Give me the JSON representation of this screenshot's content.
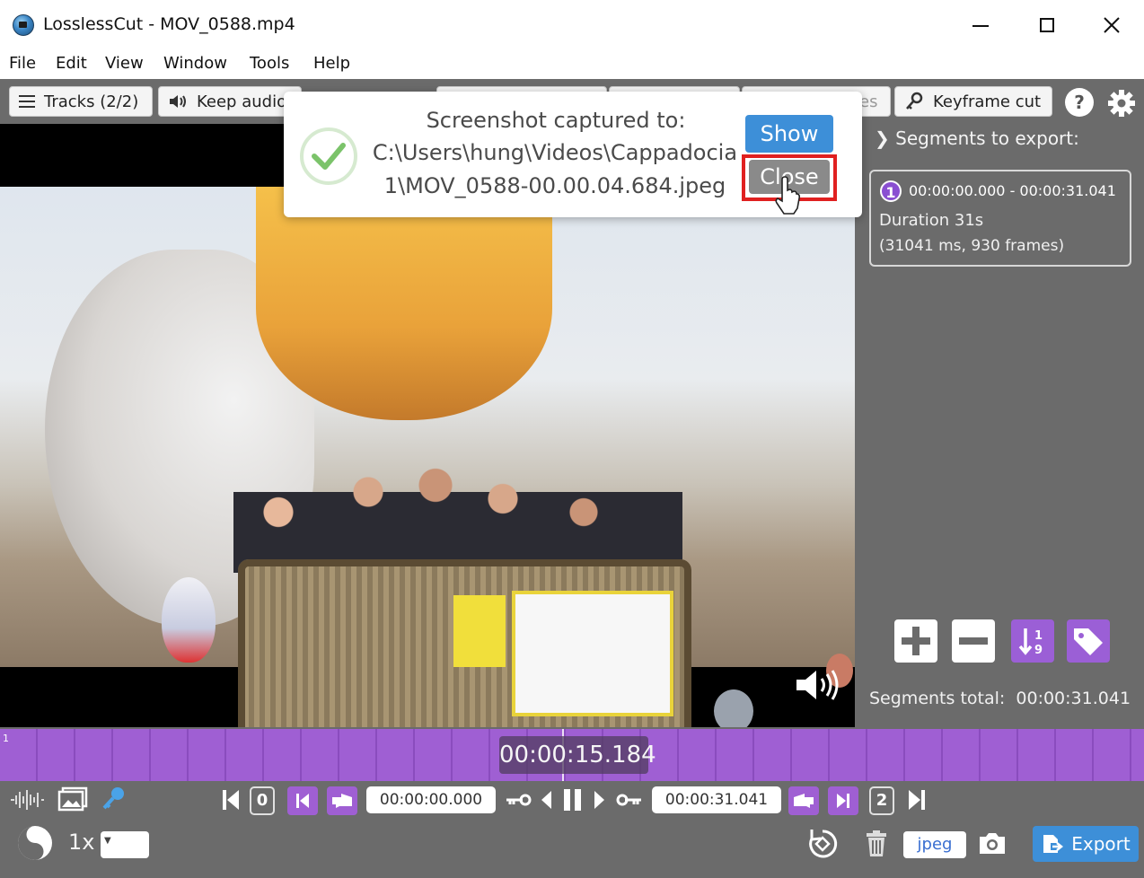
{
  "window": {
    "title": "LosslessCut - MOV_0588.mp4"
  },
  "menu": [
    "File",
    "Edit",
    "View",
    "Window",
    "Tools",
    "Help"
  ],
  "toolbar": {
    "tracks_label": "Tracks (2/2)",
    "keep_audio_label": "Keep audio",
    "hidden_tail": "es",
    "keyframe_label": "Keyframe cut"
  },
  "notification": {
    "title": "Screenshot captured to:",
    "path_line1": "C:\\Users\\hung\\Videos\\Cappadocia",
    "path_line2": "1\\MOV_0588-00.00.04.684.jpeg",
    "show_label": "Show",
    "close_label": "Close"
  },
  "segments": {
    "header": "Segments to export:",
    "items": [
      {
        "number": "1",
        "range": "00:00:00.000 - 00:00:31.041",
        "duration": "Duration 31s",
        "detail": "(31041 ms, 930 frames)"
      }
    ],
    "total_label": "Segments total:",
    "total_value": "00:00:31.041"
  },
  "timeline": {
    "segment_index": "1",
    "current_time": "00:00:15.184"
  },
  "controls": {
    "start_time": "00:00:00.000",
    "end_time": "00:00:31.041",
    "start_num": "0",
    "end_num": "2",
    "playback_rate": "1x",
    "format": "jpeg",
    "export_label": "Export"
  },
  "colors": {
    "accent_purple": "#9f5fd3",
    "accent_blue": "#3d8fd8",
    "panel_gray": "#6b6b6b",
    "highlight_red": "#e02020"
  },
  "icons": [
    "app-icon",
    "hamburger-icon",
    "speaker-icon",
    "key-icon",
    "help-icon",
    "gear-icon",
    "volume-icon",
    "waveform-icon",
    "thumbnails-icon",
    "keyframe-key-icon",
    "jump-start-icon",
    "set-cut-start-icon",
    "play-pause-icon",
    "jump-end-icon",
    "rotate-icon",
    "trash-icon",
    "camera-icon",
    "export-icon",
    "check-icon",
    "cursor-icon"
  ]
}
